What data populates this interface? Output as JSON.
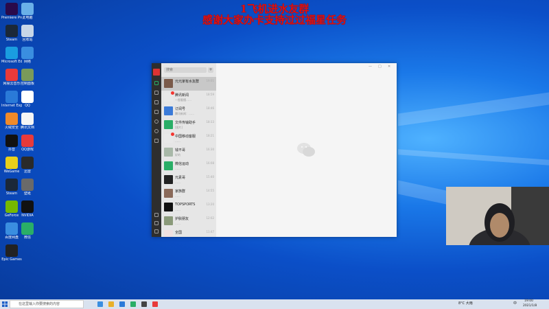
{
  "overlay": {
    "line1": "1飞机进水友群",
    "line2": "感谢大家办卡支持过过福星任务"
  },
  "desktop_icons": [
    {
      "name": "Premiere Pro",
      "color": "#2a0a4a",
      "icon": "premiere-icon"
    },
    {
      "name": "此电脑",
      "color": "#6ab0e8",
      "icon": "computer-icon"
    },
    {
      "name": "Steam",
      "color": "#1b2838",
      "icon": "steam-icon"
    },
    {
      "name": "回收站",
      "color": "#c7d6e8",
      "icon": "recycle-bin-icon"
    },
    {
      "name": "Microsoft Edge",
      "color": "#1a9de0",
      "icon": "edge-icon"
    },
    {
      "name": "网络",
      "color": "#3a8ee0",
      "icon": "network-icon"
    },
    {
      "name": "网易云音乐",
      "color": "#e83a3a",
      "icon": "music-icon"
    },
    {
      "name": "控制面板",
      "color": "#7a9a5a",
      "icon": "control-panel-icon"
    },
    {
      "name": "Internet Explorer",
      "color": "#2a7ad8",
      "icon": "ie-icon"
    },
    {
      "name": "QQ",
      "color": "#ffffff",
      "icon": "qq-icon"
    },
    {
      "name": "火绒安全",
      "color": "#f08a2a",
      "icon": "security-icon"
    },
    {
      "name": "腾讯文档",
      "color": "#f5f5f5",
      "icon": "document-icon"
    },
    {
      "name": "抖音",
      "color": "#111111",
      "icon": "tiktok-icon"
    },
    {
      "name": "QQ游戏",
      "color": "#e83a3a",
      "icon": "game-icon"
    },
    {
      "name": "WeGame",
      "color": "#e8d01a",
      "icon": "wegame-icon"
    },
    {
      "name": "迅雷",
      "color": "#2a2a2a",
      "icon": "thunder-icon"
    },
    {
      "name": "Steam",
      "color": "#1b2838",
      "icon": "steam-icon"
    },
    {
      "name": "壁纸",
      "color": "#6a6a6a",
      "icon": "wallpaper-icon"
    },
    {
      "name": "GeForce",
      "color": "#76b900",
      "icon": "geforce-icon"
    },
    {
      "name": "NVIDIA",
      "color": "#111111",
      "icon": "nvidia-icon"
    },
    {
      "name": "百度网盘",
      "color": "#3a8ee0",
      "icon": "cloud-icon"
    },
    {
      "name": "微信",
      "color": "#2aae67",
      "icon": "wechat-icon"
    },
    {
      "name": "Epic Games",
      "color": "#222222",
      "icon": "epic-icon"
    }
  ],
  "wechat": {
    "search_placeholder": "搜索",
    "plus": "+",
    "chats": [
      {
        "name": "元元家有水友群",
        "msg": "",
        "time": "19:01",
        "color": "#7a5a4a",
        "badge": false
      },
      {
        "name": "腾讯新闻",
        "msg": "一图看懂……",
        "time": "18:59",
        "color": "#e8e8e8",
        "badge": true
      },
      {
        "name": "订阅号",
        "msg": "腾讯新闻：……",
        "time": "18:46",
        "color": "#3a7ad8",
        "badge": false
      },
      {
        "name": "文件传输助手",
        "msg": "[图片]",
        "time": "18:33",
        "color": "#2aae67",
        "badge": false
      },
      {
        "name": "中国移动客服",
        "msg": "……",
        "time": "18:21",
        "color": "#e8e8e8",
        "badge": true
      },
      {
        "name": "钱不哥",
        "msg": "好的",
        "time": "16:30",
        "color": "#a8b8a8",
        "badge": false
      },
      {
        "name": "微信运动",
        "msg": "……",
        "time": "16:08",
        "color": "#2aae67",
        "badge": false
      },
      {
        "name": "元素哥",
        "msg": "……",
        "time": "15:40",
        "color": "#222222",
        "badge": false
      },
      {
        "name": "家族群",
        "msg": "……",
        "time": "14:55",
        "color": "#8a6a5a",
        "badge": false
      },
      {
        "name": "TOPSPORTS",
        "msg": "……",
        "time": "13:20",
        "color": "#111111",
        "badge": false
      },
      {
        "name": "护肤朋友",
        "msg": "……",
        "time": "12:02",
        "color": "#8a9a7a",
        "badge": false
      },
      {
        "name": "全国",
        "msg": "……",
        "time": "11:47",
        "color": "#f0e0e0",
        "badge": false
      }
    ],
    "controls": [
      "—",
      "□",
      "✕"
    ]
  },
  "taskbar": {
    "search_placeholder": "在这里输入你要搜索的内容",
    "apps": [
      {
        "color": "#3a8ee0",
        "icon": "edge-icon"
      },
      {
        "color": "#e8b02a",
        "icon": "folder-icon"
      },
      {
        "color": "#2a7ad8",
        "icon": "store-icon"
      },
      {
        "color": "#2aae67",
        "icon": "wechat-icon"
      },
      {
        "color": "#444444",
        "icon": "obs-icon"
      },
      {
        "color": "#e83a3a",
        "icon": "app-icon"
      }
    ],
    "weather": "8°C 大雨",
    "ime": "中",
    "time": "19:00",
    "date": "2021/1/8"
  }
}
